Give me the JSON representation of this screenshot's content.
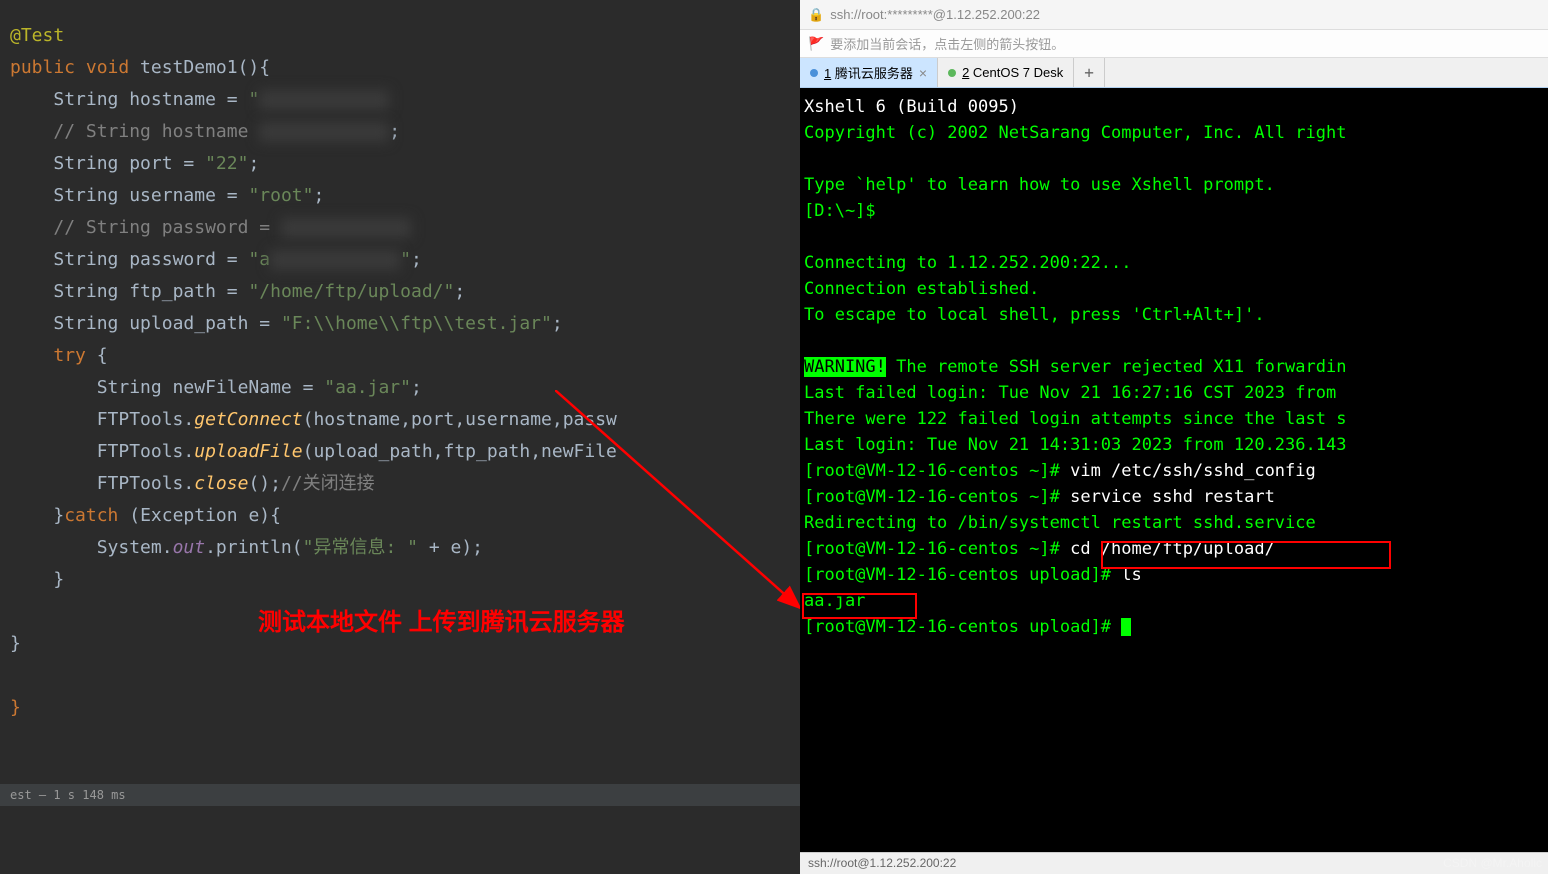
{
  "code": {
    "annotation": "@Test",
    "declare": "public void testDemo1(){",
    "l1a": "String hostname = \"",
    "l1b": "\";",
    "l2": "// String hostname ",
    "l2end": ";",
    "l3": "String port = \"22\";",
    "l4": "String username = \"root\";",
    "l5": "// String password = ",
    "l6a": "String password = \"a",
    "l6b": "\";",
    "l7a": "String ftp_path = ",
    "l7b": "\"/home/ftp/upload/\"",
    "l8a": "String upload_path = ",
    "l8b": "\"F:\\\\home\\\\ftp\\\\test.jar\"",
    "try": "try {",
    "l9a": "String newFileName = ",
    "l9b": "\"aa.jar\"",
    "l10": "FTPTools.getConnect(hostname,port,username,passw",
    "l11": "FTPTools.uploadFile(upload_path,ftp_path,newFile",
    "l12a": "FTPTools.close();",
    "l12b": "//关闭连接",
    "catch": "}catch (Exception e){",
    "l13a": "System.out.println(",
    "l13b": "\"异常信息: \"",
    "l13c": " + e);"
  },
  "annotation_red": "测试本地文件 上传到腾讯云服务器",
  "status1": "est – 1 s 148 ms",
  "address": "ssh://root:*********@1.12.252.200:22",
  "hint": "要添加当前会话，点击左侧的箭头按钮。",
  "tabs": {
    "t1": "腾讯云服务器",
    "t1n": "1",
    "t2": "CentOS 7 Desk",
    "t2n": "2"
  },
  "terminal": {
    "l1": "Xshell 6 (Build 0095)",
    "l2": "Copyright (c) 2002 NetSarang Computer, Inc. All right",
    "l4": "Type `help' to learn how to use Xshell prompt.",
    "l5": "[D:\\~]$",
    "l7": "Connecting to 1.12.252.200:22...",
    "l8": "Connection established.",
    "l9": "To escape to local shell, press 'Ctrl+Alt+]'.",
    "warn": "WARNING!",
    "l11": " The remote SSH server rejected X11 forwardin",
    "l12": "Last failed login: Tue Nov 21 16:27:16 CST 2023 from ",
    "l13": "There were 122 failed login attempts since the last s",
    "l14": "Last login: Tue Nov 21 14:31:03 2023 from 120.236.143",
    "p1": "[root@VM-12-16-centos ~]# ",
    "c1": "vim /etc/ssh/sshd_config",
    "c2": "service sshd restart",
    "l17": "Redirecting to /bin/systemctl restart sshd.service",
    "c3": "cd /home/ftp/upload/",
    "p2": "[root@VM-12-16-centos upload]# ",
    "c4": "ls",
    "file": "aa.jar"
  },
  "term_status": "ssh://root@1.12.252.200:22",
  "watermark": "CSDN @Mr.Aholic"
}
